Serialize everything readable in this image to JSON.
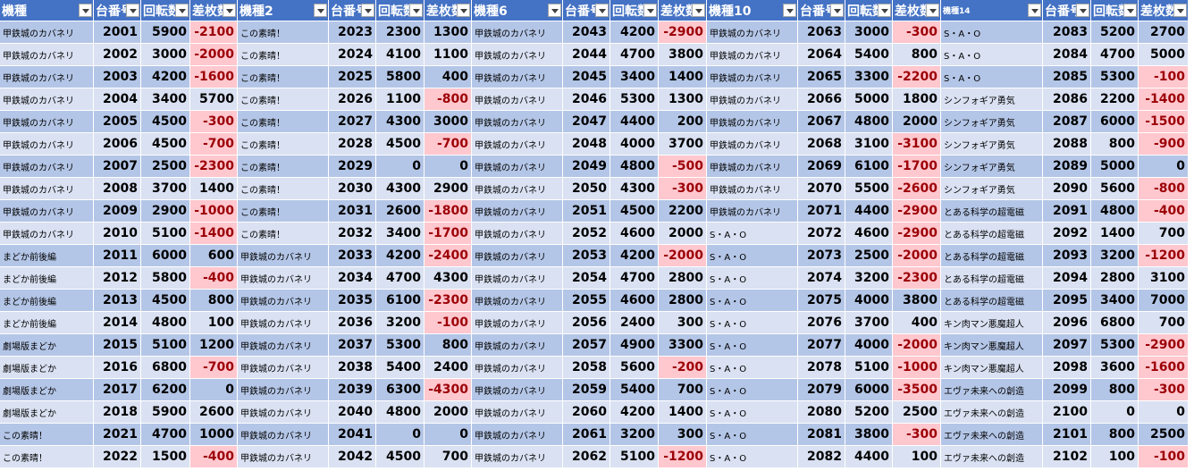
{
  "columns": [
    {
      "header": "機種",
      "type": "text",
      "width": 105
    },
    {
      "header": "台番号",
      "type": "num",
      "width": 53
    },
    {
      "header": "回転数",
      "type": "num",
      "width": 55
    },
    {
      "header": "差枚数",
      "type": "num",
      "width": 53
    },
    {
      "header": "機種2",
      "type": "text",
      "width": 102
    },
    {
      "header": "台番号",
      "type": "num",
      "width": 53
    },
    {
      "header": "回転数",
      "type": "num",
      "width": 54
    },
    {
      "header": "差枚数",
      "type": "num",
      "width": 53
    },
    {
      "header": "機種6",
      "type": "text",
      "width": 102
    },
    {
      "header": "台番号",
      "type": "num",
      "width": 53
    },
    {
      "header": "回転数",
      "type": "num",
      "width": 54
    },
    {
      "header": "差枚数",
      "type": "num",
      "width": 54
    },
    {
      "header": "機種10",
      "type": "text",
      "width": 102
    },
    {
      "header": "台番号",
      "type": "num",
      "width": 53
    },
    {
      "header": "回転数",
      "type": "num",
      "width": 53
    },
    {
      "header": "差枚数",
      "type": "num",
      "width": 54
    },
    {
      "header": "機種14",
      "type": "text",
      "width": 114,
      "small": true
    },
    {
      "header": "台番号",
      "type": "num",
      "width": 54
    },
    {
      "header": "回転数",
      "type": "num",
      "width": 53
    },
    {
      "header": "差枚数",
      "type": "num",
      "width": 56
    }
  ],
  "rows": [
    [
      "甲鉄城のカバネリ",
      2001,
      5900,
      -2100,
      "この素晴！",
      2023,
      2300,
      1300,
      "甲鉄城のカバネリ",
      2043,
      4200,
      -2900,
      "甲鉄城のカバネリ",
      2063,
      3000,
      -300,
      "S・A・O",
      2083,
      5200,
      2700
    ],
    [
      "甲鉄城のカバネリ",
      2002,
      3000,
      -2000,
      "この素晴！",
      2024,
      4100,
      1100,
      "甲鉄城のカバネリ",
      2044,
      4700,
      3800,
      "甲鉄城のカバネリ",
      2064,
      5400,
      800,
      "S・A・O",
      2084,
      4700,
      5000
    ],
    [
      "甲鉄城のカバネリ",
      2003,
      4200,
      -1600,
      "この素晴！",
      2025,
      5800,
      400,
      "甲鉄城のカバネリ",
      2045,
      3400,
      1400,
      "甲鉄城のカバネリ",
      2065,
      3300,
      -2200,
      "S・A・O",
      2085,
      5300,
      -100
    ],
    [
      "甲鉄城のカバネリ",
      2004,
      3400,
      5700,
      "この素晴！",
      2026,
      1100,
      -800,
      "甲鉄城のカバネリ",
      2046,
      5300,
      1300,
      "甲鉄城のカバネリ",
      2066,
      5000,
      1800,
      "シンフォギア勇気",
      2086,
      2200,
      -1400
    ],
    [
      "甲鉄城のカバネリ",
      2005,
      4500,
      -300,
      "この素晴！",
      2027,
      4300,
      3000,
      "甲鉄城のカバネリ",
      2047,
      4400,
      200,
      "甲鉄城のカバネリ",
      2067,
      4800,
      2000,
      "シンフォギア勇気",
      2087,
      6000,
      -1500
    ],
    [
      "甲鉄城のカバネリ",
      2006,
      4500,
      -700,
      "この素晴！",
      2028,
      4500,
      -700,
      "甲鉄城のカバネリ",
      2048,
      4000,
      3700,
      "甲鉄城のカバネリ",
      2068,
      3100,
      -3100,
      "シンフォギア勇気",
      2088,
      800,
      -900
    ],
    [
      "甲鉄城のカバネリ",
      2007,
      2500,
      -2300,
      "この素晴！",
      2029,
      0,
      0,
      "甲鉄城のカバネリ",
      2049,
      4800,
      -500,
      "甲鉄城のカバネリ",
      2069,
      6100,
      -1700,
      "シンフォギア勇気",
      2089,
      5000,
      0
    ],
    [
      "甲鉄城のカバネリ",
      2008,
      3700,
      1400,
      "この素晴！",
      2030,
      4300,
      2900,
      "甲鉄城のカバネリ",
      2050,
      4300,
      -300,
      "甲鉄城のカバネリ",
      2070,
      5500,
      -2600,
      "シンフォギア勇気",
      2090,
      5600,
      -800
    ],
    [
      "甲鉄城のカバネリ",
      2009,
      2900,
      -1000,
      "この素晴！",
      2031,
      2600,
      -1800,
      "甲鉄城のカバネリ",
      2051,
      4500,
      2200,
      "甲鉄城のカバネリ",
      2071,
      4400,
      -2900,
      "とある科学の超電磁",
      2091,
      4800,
      -400
    ],
    [
      "甲鉄城のカバネリ",
      2010,
      5100,
      -1400,
      "この素晴！",
      2032,
      3400,
      -1700,
      "甲鉄城のカバネリ",
      2052,
      4600,
      2000,
      "S・A・O",
      2072,
      4600,
      -2900,
      "とある科学の超電磁",
      2092,
      1400,
      700
    ],
    [
      "まどか前後編",
      2011,
      6000,
      600,
      "甲鉄城のカバネリ",
      2033,
      4200,
      -2400,
      "甲鉄城のカバネリ",
      2053,
      4200,
      -2000,
      "S・A・O",
      2073,
      2500,
      -2000,
      "とある科学の超電磁",
      2093,
      3200,
      -1200
    ],
    [
      "まどか前後編",
      2012,
      5800,
      -400,
      "甲鉄城のカバネリ",
      2034,
      4700,
      4300,
      "甲鉄城のカバネリ",
      2054,
      4700,
      2800,
      "S・A・O",
      2074,
      3200,
      -2300,
      "とある科学の超電磁",
      2094,
      2800,
      3100
    ],
    [
      "まどか前後編",
      2013,
      4500,
      800,
      "甲鉄城のカバネリ",
      2035,
      6100,
      -2300,
      "甲鉄城のカバネリ",
      2055,
      4600,
      2800,
      "S・A・O",
      2075,
      4000,
      3800,
      "とある科学の超電磁",
      2095,
      3400,
      7000
    ],
    [
      "まどか前後編",
      2014,
      4800,
      100,
      "甲鉄城のカバネリ",
      2036,
      3200,
      -100,
      "甲鉄城のカバネリ",
      2056,
      2400,
      300,
      "S・A・O",
      2076,
      3700,
      400,
      "キン肉マン悪魔超人",
      2096,
      6800,
      700
    ],
    [
      "劇場版まどか",
      2015,
      5100,
      1200,
      "甲鉄城のカバネリ",
      2037,
      5300,
      800,
      "甲鉄城のカバネリ",
      2057,
      4900,
      3300,
      "S・A・O",
      2077,
      4000,
      -2000,
      "キン肉マン悪魔超人",
      2097,
      5300,
      -2900
    ],
    [
      "劇場版まどか",
      2016,
      6800,
      -700,
      "甲鉄城のカバネリ",
      2038,
      5400,
      2400,
      "甲鉄城のカバネリ",
      2058,
      5600,
      -200,
      "S・A・O",
      2078,
      5100,
      -1000,
      "キン肉マン悪魔超人",
      2098,
      3600,
      -1600
    ],
    [
      "劇場版まどか",
      2017,
      6200,
      0,
      "甲鉄城のカバネリ",
      2039,
      6300,
      -4300,
      "甲鉄城のカバネリ",
      2059,
      5400,
      700,
      "S・A・O",
      2079,
      6000,
      -3500,
      "エヴァ未来への創造",
      2099,
      800,
      -300
    ],
    [
      "劇場版まどか",
      2018,
      5900,
      2600,
      "甲鉄城のカバネリ",
      2040,
      4800,
      2000,
      "甲鉄城のカバネリ",
      2060,
      4200,
      1400,
      "S・A・O",
      2080,
      5200,
      2500,
      "エヴァ未来への創造",
      2100,
      0,
      0
    ],
    [
      "この素晴！",
      2021,
      4700,
      1000,
      "甲鉄城のカバネリ",
      2041,
      0,
      0,
      "甲鉄城のカバネリ",
      2061,
      3200,
      300,
      "S・A・O",
      2081,
      3800,
      -300,
      "エヴァ未来への創造",
      2101,
      800,
      2500
    ],
    [
      "この素晴！",
      2022,
      1500,
      -400,
      "甲鉄城のカバネリ",
      2042,
      4500,
      700,
      "甲鉄城のカバネリ",
      2062,
      5100,
      -1200,
      "S・A・O",
      2082,
      4400,
      100,
      "エヴァ未来への創造",
      2102,
      100,
      -100
    ]
  ],
  "colors": {
    "header_bg": "#4472c4",
    "row_dark": "#b4c6e7",
    "row_light": "#d9e1f2",
    "negative_bg": "#ffc7ce",
    "negative_text": "#9c0006"
  },
  "icons": {
    "filter": "filter-dropdown-icon"
  }
}
